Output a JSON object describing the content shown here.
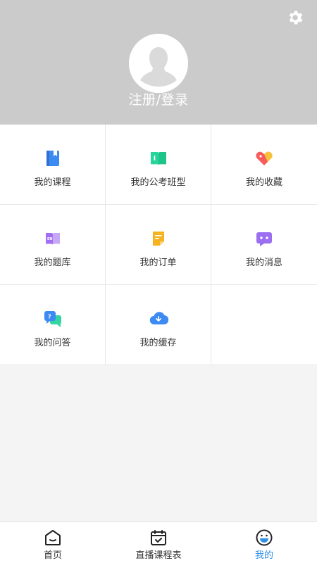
{
  "header": {
    "login_label": "注册/登录",
    "settings_icon": "gear-icon",
    "avatar_icon": "avatar-placeholder"
  },
  "menu": {
    "items": [
      {
        "label": "我的课程",
        "icon": "book-icon",
        "color": "#3d8bf2"
      },
      {
        "label": "我的公考班型",
        "icon": "open-book-icon",
        "color": "#27d59a"
      },
      {
        "label": "我的收藏",
        "icon": "heart-tag-icon",
        "color": "#f65a5a"
      },
      {
        "label": "我的题库",
        "icon": "question-bank-icon",
        "color": "#a26ff2"
      },
      {
        "label": "我的订单",
        "icon": "order-icon",
        "color": "#f6b320"
      },
      {
        "label": "我的消息",
        "icon": "message-icon",
        "color": "#9b6ff0"
      },
      {
        "label": "我的问答",
        "icon": "qa-icon",
        "color": "#3d8bf2"
      },
      {
        "label": "我的缓存",
        "icon": "cloud-download-icon",
        "color": "#3d8bf2"
      }
    ]
  },
  "tabbar": {
    "tabs": [
      {
        "label": "首页",
        "icon": "home-icon"
      },
      {
        "label": "直播课程表",
        "icon": "calendar-check-icon"
      },
      {
        "label": "我的",
        "icon": "profile-face-icon",
        "active": true
      }
    ],
    "active_color": "#2f8fe6"
  }
}
